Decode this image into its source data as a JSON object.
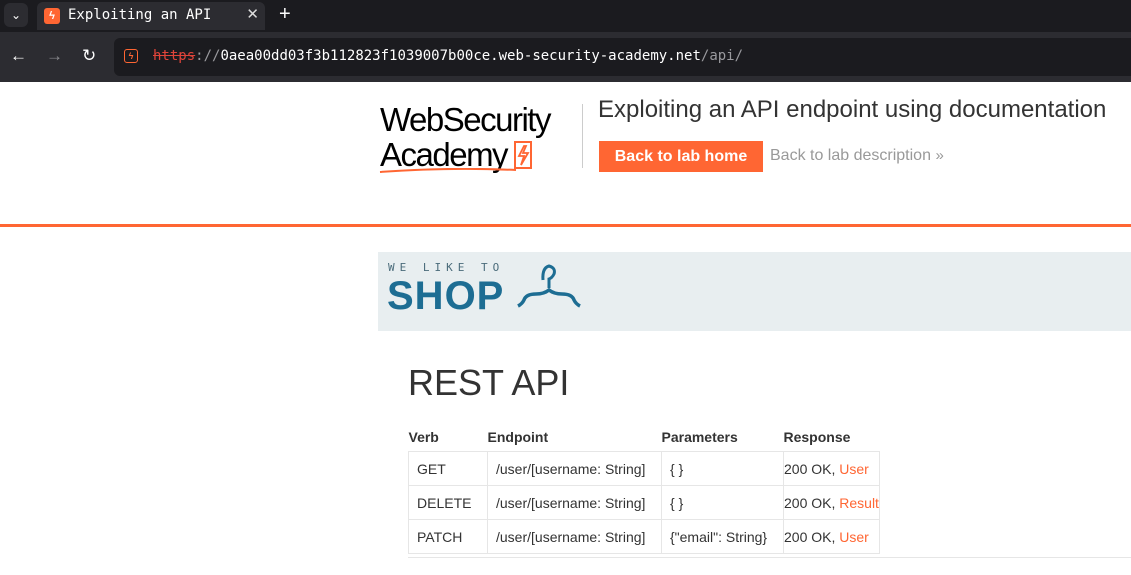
{
  "browser": {
    "tab_title": "Exploiting an API",
    "url_scheme": "https",
    "url_separator": "://",
    "url_host": "0aea00dd03f3b112823f1039007b00ce.web-security-academy.net",
    "url_path": "/api/"
  },
  "header": {
    "logo_line1": "WebSecurity",
    "logo_line2": "Academy",
    "lab_title": "Exploiting an API endpoint using documentation",
    "back_home_label": "Back to lab home",
    "back_desc_label": "Back to lab description",
    "accent_color": "#ff6633"
  },
  "banner": {
    "small_text": "WE LIKE TO",
    "big_text": "SHOP"
  },
  "main": {
    "title": "REST API",
    "columns": [
      "Verb",
      "Endpoint",
      "Parameters",
      "Response"
    ],
    "rows": [
      {
        "verb": "GET",
        "endpoint": "/user/[username: String]",
        "params": "{ }",
        "status": "200 OK,",
        "result": "User"
      },
      {
        "verb": "DELETE",
        "endpoint": "/user/[username: String]",
        "params": "{ }",
        "status": "200 OK,",
        "result": "Result"
      },
      {
        "verb": "PATCH",
        "endpoint": "/user/[username: String]",
        "params": "{\"email\": String}",
        "status": "200 OK,",
        "result": "User"
      }
    ]
  }
}
